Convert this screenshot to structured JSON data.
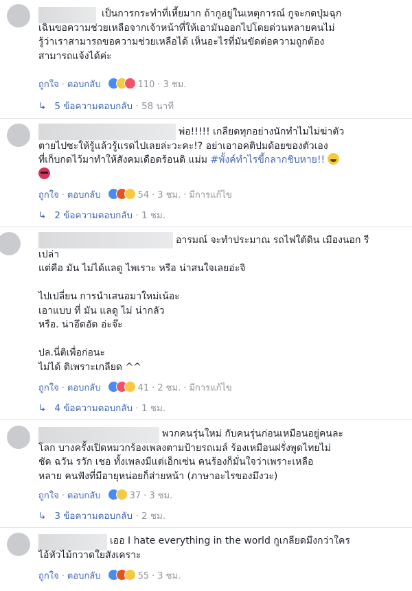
{
  "labels": {
    "like": "ถูกใจ",
    "reply": "ตอบกลับ",
    "edited": "มีการแก้ไข",
    "sep": "·"
  },
  "comments": [
    {
      "text": "เป็นการกระทำที่เหี้ยมาก ถ้ากูอยู่ในเหตุการณ์ กูจะกดปุ่มฉุก\nเฉินขอความช่วยเหลือจากเจ้าหน้าที่ให้เอามันออกไปโดยด่วนหลายคนไม่\nรู้ว่าเราสามารถขอความช่วยเหลือได้ เห็นอะไรที่มันขัดต่อความถูกต้อง\nสามารถแจ้งได้ค่ะ",
      "reaction_count": "110",
      "time": "3 ชม.",
      "replies_label": "5 ข้อความตอบกลับ",
      "replies_time": "58 นาที"
    },
    {
      "text_before": "พ่อ!!!!! เกลียดทุกอย่างนักทำไมไม่ฆ่าตัว\nตายไปซะให้รู้แล้วรู้แรดไปเลยล่ะวะคะ!? อย่าเอาอคติปมด้อยของตัวเอง\nที่เก็บกดไว้มาทำให้สังคมเดือดร้อนดิ แม่ม ",
      "hashtag": "#พั้งค์ทำไรขี้กลากชิบหาย!!",
      "reaction_count": "54",
      "time": "3 ชม.",
      "replies_label": "2 ข้อความตอบกลับ",
      "replies_time": "1 ชม."
    },
    {
      "text": "อารมณ์ จะทำประมาณ รถไฟใต้ดิน เมืองนอก รี\nเปล่า\nแต่คือ มัน ไม่ได้แลดู ไพเราะ หรือ น่าสนใจเลยอ่ะจิ\n\nไปเปลี่ยน การนำเสนอมาใหม่เน้อะ\nเอาแบบ ที่ มัน แลดู ไม่ น่ากลัว\nหรือ. น่าอึดอัด อ่ะจ๊ะ\n\nปล.นี่ติเพื่อก่อนะ\nไม่ได้ ติเพราะเกลียด ^^",
      "reaction_count": "41",
      "time": "2 ชม.",
      "replies_label": "4 ข้อความตอบกลับ",
      "replies_time": "1 ชม."
    },
    {
      "text": "พวกคนรุ่นใหม่ กับคนรุ่นก่อนเหมือนอยู่คนละ\nโลก บางครั้งเปิดหมวกร้องเพลงตามป้ายรถเมล์ ร้องเหมือนฝรั่งพูดไทยไม่\nชัด ฉวัน รวัก เชอ ทั้งเพลงมีแต่เอ็กเซ่น คนร้องก็มั่นใจว่าเพราะเหลือ\nหลาย คนฟังที่มีอายุหน่อยก็ส่ายหน้า (ภาษาอะไรของมึงวะ)",
      "reaction_count": "37",
      "time": "3 ชม.",
      "replies_label": "3 ข้อความตอบกลับ",
      "replies_time": "2 ชม."
    },
    {
      "text": "เออ I hate everything in the world กูเกลียดมึงกว่าใคร\nไอ้หัวไม้กวาดใยสังเคราะ",
      "reaction_count": "55",
      "time": "3 ชม."
    }
  ]
}
